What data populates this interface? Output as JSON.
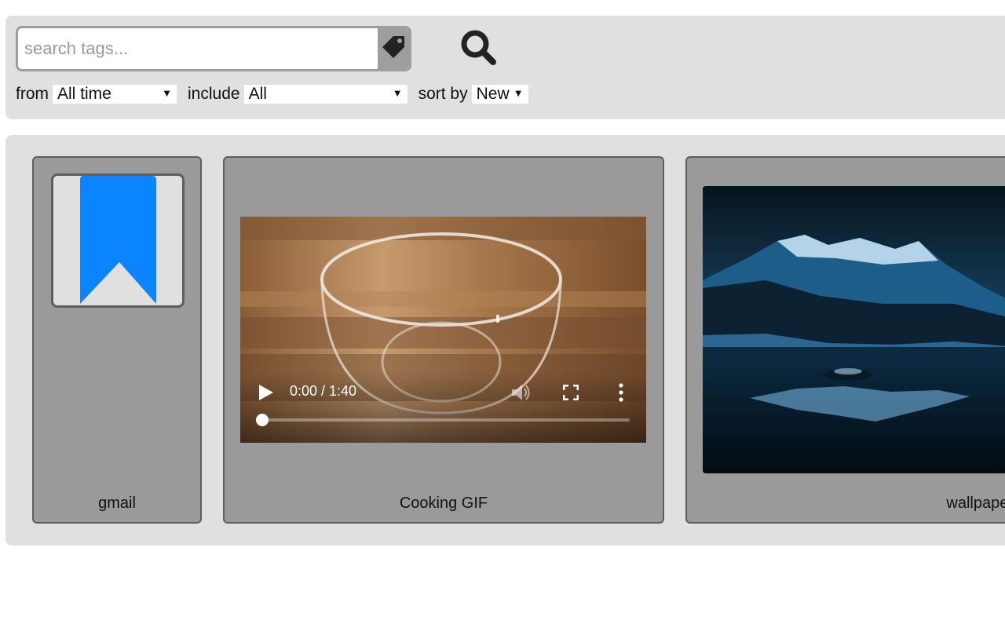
{
  "search": {
    "placeholder": "search tags...",
    "value": ""
  },
  "filters": {
    "from_label": "from",
    "from_value": "All time",
    "include_label": "include",
    "include_value": "All",
    "sort_label": "sort by",
    "sort_value": "New"
  },
  "icons": {
    "tag": "tag-icon",
    "search": "magnifier-icon",
    "bookmark": "bookmark-icon",
    "play": "play-icon",
    "volume": "volume-icon",
    "fullscreen": "fullscreen-icon",
    "more": "more-vertical-icon"
  },
  "cards": [
    {
      "label": "gmail",
      "type": "bookmark",
      "accent": "#0a84ff"
    },
    {
      "label": "Cooking GIF",
      "type": "video",
      "time": "0:00 / 1:40",
      "progress": 0.0
    },
    {
      "label": "wallpaper",
      "type": "image"
    }
  ],
  "colors": {
    "panel_bg": "#e0e0e0",
    "card_bg": "#9a9a9a",
    "card_border": "#5e5e5e",
    "bookmark_blue": "#0a84ff"
  }
}
